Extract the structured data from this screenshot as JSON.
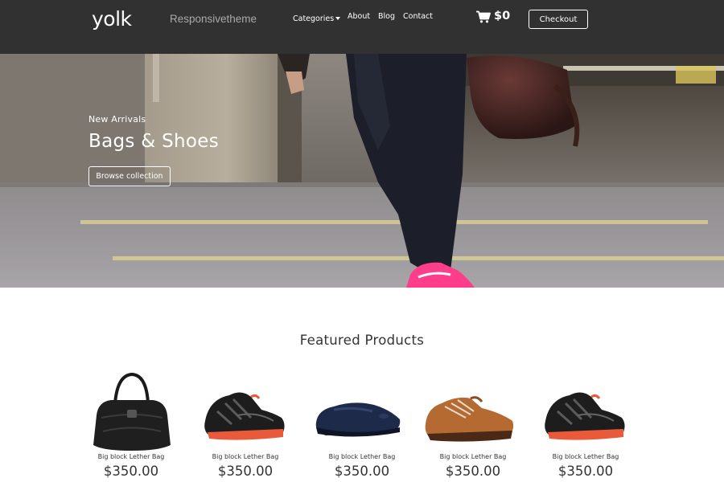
{
  "header": {
    "logo": "yolk",
    "tagline": "Responsivetheme",
    "nav": {
      "categories": "Categories",
      "about": "About",
      "blog": "Blog",
      "contact": "Contact"
    },
    "cart_total": "$0",
    "checkout_label": "Checkout"
  },
  "hero": {
    "eyebrow": "New Arrivals",
    "title": "Bags & Shoes",
    "button_label": "Browse collection"
  },
  "featured": {
    "title": "Featured Products",
    "products": [
      {
        "name": "Big block Lether Bag",
        "price": "$350.00",
        "image": "black-leather-handbag"
      },
      {
        "name": "Big block Lether Bag",
        "price": "$350.00",
        "image": "black-running-shoe"
      },
      {
        "name": "Big block Lether Bag",
        "price": "$350.00",
        "image": "navy-loafer"
      },
      {
        "name": "Big block Lether Bag",
        "price": "$350.00",
        "image": "brown-casual-shoe"
      },
      {
        "name": "Big block Lether Bag",
        "price": "$350.00",
        "image": "black-running-shoe"
      }
    ]
  },
  "colors": {
    "header_bg": "#313131",
    "accent_pink": "#ff3d8b",
    "text_dark": "#333333"
  }
}
